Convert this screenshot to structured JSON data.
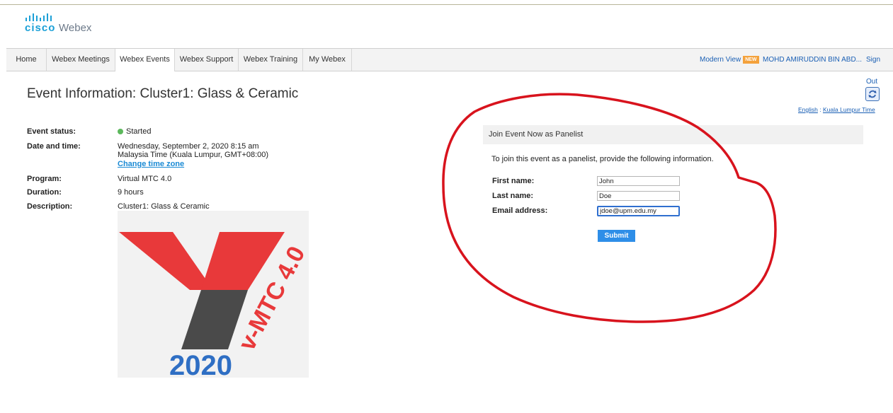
{
  "brand": {
    "cisco": "cisco",
    "product": "Webex"
  },
  "nav": {
    "tabs": [
      {
        "label": "Home"
      },
      {
        "label": "Webex Meetings"
      },
      {
        "label": "Webex Events",
        "active": true
      },
      {
        "label": "Webex Support"
      },
      {
        "label": "Webex Training"
      },
      {
        "label": "My Webex"
      }
    ],
    "modern_view": "Modern View",
    "new_badge": "NEW",
    "user_name": "MOHD AMIRUDDIN BIN ABD...",
    "sign_out": "Sign Out"
  },
  "page": {
    "title": "Event Information: Cluster1: Glass & Ceramic",
    "language": "English",
    "separator": " : ",
    "timezone_link": "Kuala Lumpur Time"
  },
  "event": {
    "status_label": "Event status:",
    "status_value": "Started",
    "date_label": "Date and time:",
    "date_line1": "Wednesday, September 2, 2020 8:15 am",
    "date_line2": "Malaysia Time (Kuala Lumpur, GMT+08:00)",
    "change_tz": "Change time zone",
    "program_label": "Program:",
    "program_value": "Virtual MTC 4.0",
    "duration_label": "Duration:",
    "duration_value": "9 hours",
    "description_label": "Description:",
    "description_value": "Cluster1: Glass & Ceramic",
    "logo_text": "v-MTC 4.0",
    "logo_year": "2020"
  },
  "join": {
    "header": "Join Event Now as Panelist",
    "instructions": "To join this event as a panelist, provide the following information.",
    "first_name_label": "First name:",
    "first_name_value": "John",
    "last_name_label": "Last name:",
    "last_name_value": "Doe",
    "email_label": "Email address:",
    "email_value": "jdoe@upm.edu.my",
    "submit": "Submit"
  },
  "colors": {
    "brand_blue": "#1ba0d7",
    "link_blue": "#1a5fb4",
    "submit_blue": "#2e8ee8",
    "status_green": "#5cb85c",
    "annotation_red": "#d8131d",
    "logo_red": "#e8393a",
    "logo_gray": "#4a4a4a",
    "logo_year_blue": "#2f6fc4"
  }
}
